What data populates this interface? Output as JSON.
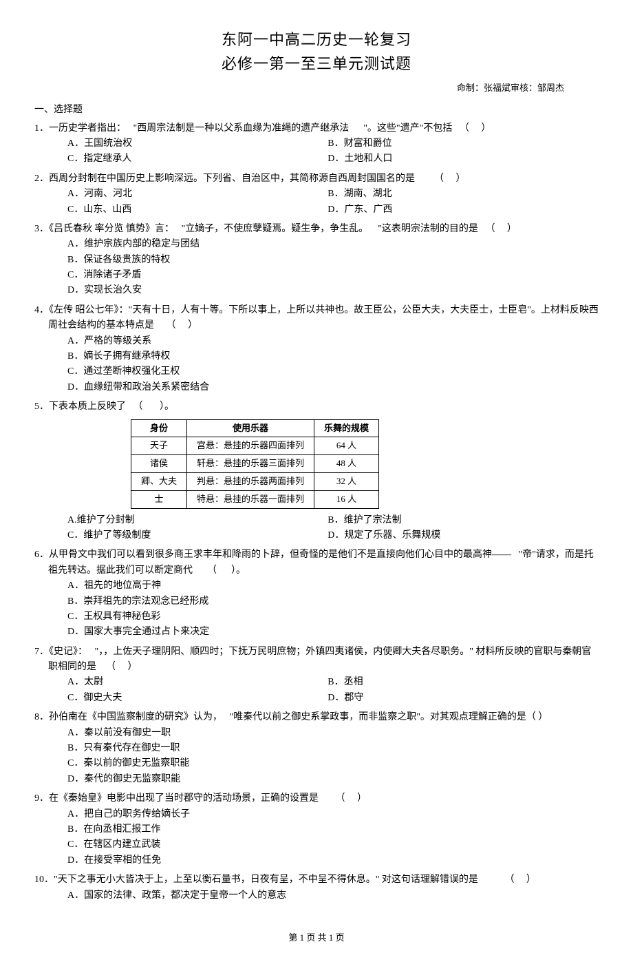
{
  "header": {
    "title1": "东阿一中高二历史一轮复习",
    "title2": "必修一第一至三单元测试题",
    "credit": "命制：张福斌审核：邹周杰"
  },
  "section_title": "一、选择题",
  "questions": [
    {
      "num": "1．",
      "stem_parts": [
        "一历史学者指出：",
        "\"西周宗法制是一种以父系血缘为准绳的遗产继承法",
        "\"。这些\"遗产\"不包括",
        "（     ）"
      ],
      "layout": "2col",
      "options": [
        {
          "label": "A．王国统治权"
        },
        {
          "label": "B．财富和爵位"
        },
        {
          "label": "C．指定继承人"
        },
        {
          "label": "D．土地和人口"
        }
      ]
    },
    {
      "num": "2．",
      "stem_parts": [
        "西周分封制在中国历史上影响深远。下列省、自治区中，其简称源自西周封国国名的是",
        "（     ）"
      ],
      "layout": "2col",
      "options": [
        {
          "label": "A．河南、河北"
        },
        {
          "label": "B．湖南、湖北"
        },
        {
          "label": "C．山东、山西"
        },
        {
          "label": "D．广东、广西"
        }
      ]
    },
    {
      "num": "3．",
      "stem_parts": [
        "《吕氏春秋  率分览  慎势》言：",
        "\"立嫡子，不使庶孽疑焉。疑生争，争生乱。",
        "\"这表明宗法制的目的是",
        "（     ）"
      ],
      "layout": "1col",
      "options": [
        {
          "label": "A．维护宗族内部的稳定与团结"
        },
        {
          "label": "B．保证各级贵族的特权"
        },
        {
          "label": "C．消除诸子矛盾"
        },
        {
          "label": "D．实现长治久安"
        }
      ]
    },
    {
      "num": "4．",
      "stem_parts": [
        "《左传  昭公七年》：\"天有十日，人有十等。下所以事上，上所以共神也。故王臣公，公臣大夫，大夫臣士，士臣皂\"。上材料反映西周社会结构的基本特点是",
        "（     ）"
      ],
      "layout": "1col",
      "options": [
        {
          "label": "A．严格的等级关系"
        },
        {
          "label": "B．嫡长子拥有继承特权"
        },
        {
          "label": "C．通过垄断神权强化王权"
        },
        {
          "label": "D．血缘纽带和政治关系紧密结合"
        }
      ]
    },
    {
      "num": "5．",
      "stem_parts": [
        "下表本质上反映了",
        "（       ）。"
      ],
      "layout": "2col",
      "options": [
        {
          "label": "A.维护了分封制"
        },
        {
          "label": "B．维护了宗法制"
        },
        {
          "label": "C．维护了等级制度"
        },
        {
          "label": "D．规定了乐器、乐舞规模"
        }
      ]
    },
    {
      "num": "6．",
      "stem_parts": [
        "从甲骨文中我们可以看到很多商王求丰年和降雨的卜辞，但奇怪的是他们不是直接向他们心目中的最高神——",
        "\"帝\"请求，而是托祖先转达。据此我们可以断定商代",
        "（      ）。"
      ],
      "layout": "1col",
      "options": [
        {
          "label": "A．祖先的地位高于神"
        },
        {
          "label": "B．崇拜祖先的宗法观念已经形成"
        },
        {
          "label": "C．王权具有神秘色彩"
        },
        {
          "label": "D．国家大事完全通过占卜来决定"
        }
      ]
    },
    {
      "num": "7．",
      "stem_parts": [
        "《史记》：",
        "\"，，上佐天子理阴阳、顺四时；下抚万民明庶物；外镇四夷诸侯，内使卿大夫各尽职务。\" 材料所反映的官职与秦朝官职相同的是",
        "（     ）"
      ],
      "layout": "2col",
      "options": [
        {
          "label": "A．太尉"
        },
        {
          "label": "B．丞相"
        },
        {
          "label": "C．御史大夫"
        },
        {
          "label": "D．郡守"
        }
      ]
    },
    {
      "num": "8．",
      "stem_parts": [
        "孙伯南在《中国监察制度的研究》认为，",
        "\"唯秦代以前之御史系掌政事，而非监察之职\"。对其观点理解正确的是（      ）"
      ],
      "layout": "1col",
      "options": [
        {
          "label": "A．秦以前没有御史一职"
        },
        {
          "label": "B．只有秦代存在御史一职"
        },
        {
          "label": "C．秦以前的御史无监察职能"
        },
        {
          "label": "D．秦代的御史无监察职能"
        }
      ]
    },
    {
      "num": "9．",
      "stem_parts": [
        "在《秦始皇》电影中出现了当时郡守的活动场景，正确的设置是",
        "（     ）"
      ],
      "layout": "1col",
      "options": [
        {
          "label": "A．把自己的职务传给嫡长子"
        },
        {
          "label": "B．在向丞相汇报工作"
        },
        {
          "label": "C．在辖区内建立武装"
        },
        {
          "label": "D．在接受宰相的任免"
        }
      ]
    },
    {
      "num": "10．",
      "stem_parts": [
        "\"天下之事无小大皆决于上，上至以衡石量书，日夜有呈，不中呈不得休息。\" 对这句话理解错误的是",
        "（     ）"
      ],
      "layout": "1col",
      "options": [
        {
          "label": "A．国家的法律、政策，都决定于皇帝一个人的意志"
        }
      ]
    }
  ],
  "table": {
    "headers": [
      "身份",
      "使用乐器",
      "乐舞的规模"
    ],
    "rows": [
      [
        "天子",
        "宫悬：悬挂的乐器四面排列",
        "64 人"
      ],
      [
        "诸侯",
        "轩悬：悬挂的乐器三面排列",
        "48 人"
      ],
      [
        "卿、大夫",
        "判悬：悬挂的乐器两面排列",
        "32 人"
      ],
      [
        "士",
        "特悬：悬挂的乐器一面排列",
        "16 人"
      ]
    ]
  },
  "footer": "第 1 页 共 1 页",
  "chart_data": {
    "type": "table",
    "title": "身份与乐器乐舞规模",
    "columns": [
      "身份",
      "使用乐器",
      "乐舞的规模(人)"
    ],
    "rows": [
      {
        "identity": "天子",
        "instrument": "宫悬：悬挂的乐器四面排列",
        "scale": 64
      },
      {
        "identity": "诸侯",
        "instrument": "轩悬：悬挂的乐器三面排列",
        "scale": 48
      },
      {
        "identity": "卿、大夫",
        "instrument": "判悬：悬挂的乐器两面排列",
        "scale": 32
      },
      {
        "identity": "士",
        "instrument": "特悬：悬挂的乐器一面排列",
        "scale": 16
      }
    ]
  }
}
